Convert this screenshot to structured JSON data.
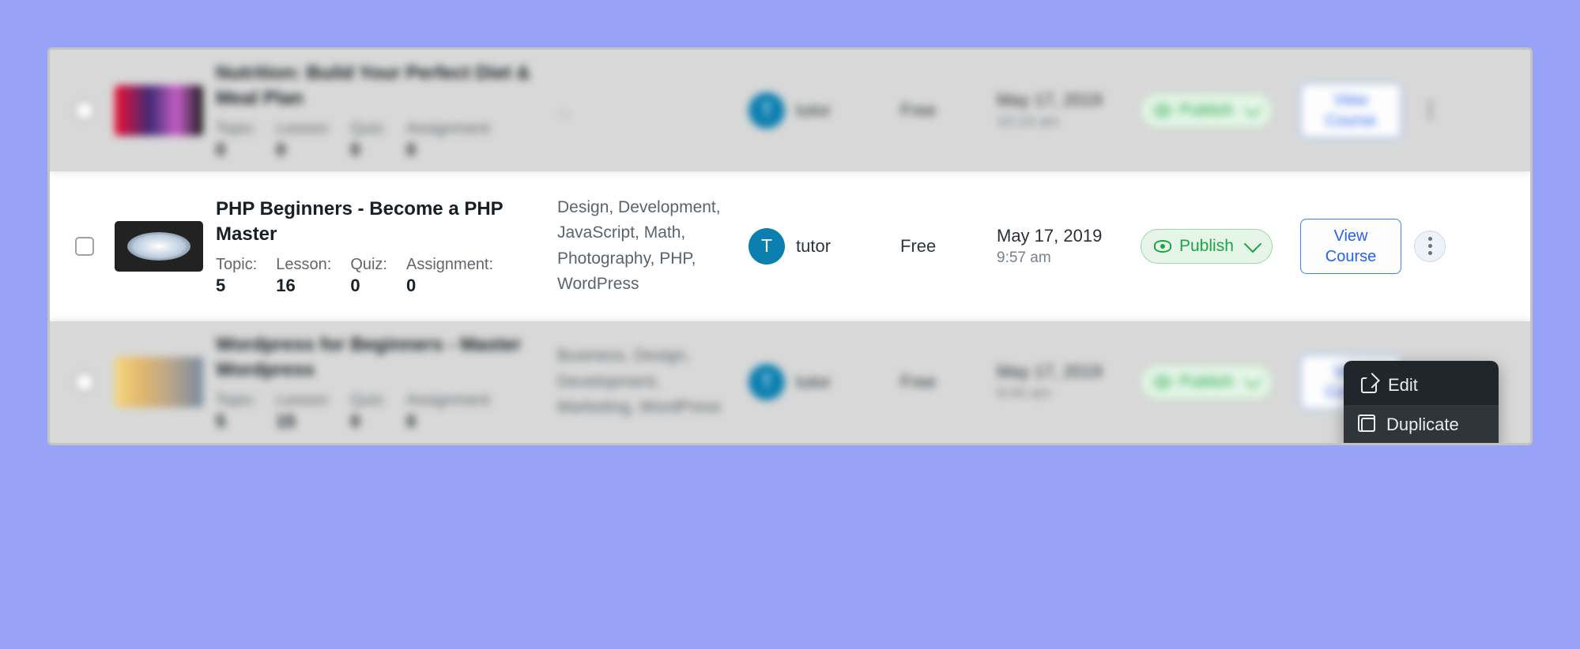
{
  "labels": {
    "topic": "Topic:",
    "lesson": "Lesson:",
    "quiz": "Quiz:",
    "assignment": "Assignment:",
    "publish": "Publish",
    "view_course": "View Course",
    "author_initial": "T"
  },
  "dropdown": {
    "edit": "Edit",
    "duplicate": "Duplicate"
  },
  "rows": [
    {
      "title": "Nutrition: Build Your Perfect Diet & Meal Plan",
      "topic": "0",
      "lesson": "0",
      "quiz": "0",
      "assignment": "0",
      "tags": "...",
      "author": "tutor",
      "price": "Free",
      "date": "May 17, 2019",
      "time": "10:14 am"
    },
    {
      "title": "PHP Beginners - Become a PHP Master",
      "topic": "5",
      "lesson": "16",
      "quiz": "0",
      "assignment": "0",
      "tags": "Design, Development, JavaScript, Math, Photography, PHP, WordPress",
      "author": "tutor",
      "price": "Free",
      "date": "May 17, 2019",
      "time": "9:57 am"
    },
    {
      "title": "Wordpress for Beginners - Master Wordpress",
      "topic": "5",
      "lesson": "15",
      "quiz": "0",
      "assignment": "0",
      "tags": "Business, Design, Development, Marketing, WordPress",
      "author": "tutor",
      "price": "Free",
      "date": "May 17, 2019",
      "time": "9:44 am"
    }
  ]
}
